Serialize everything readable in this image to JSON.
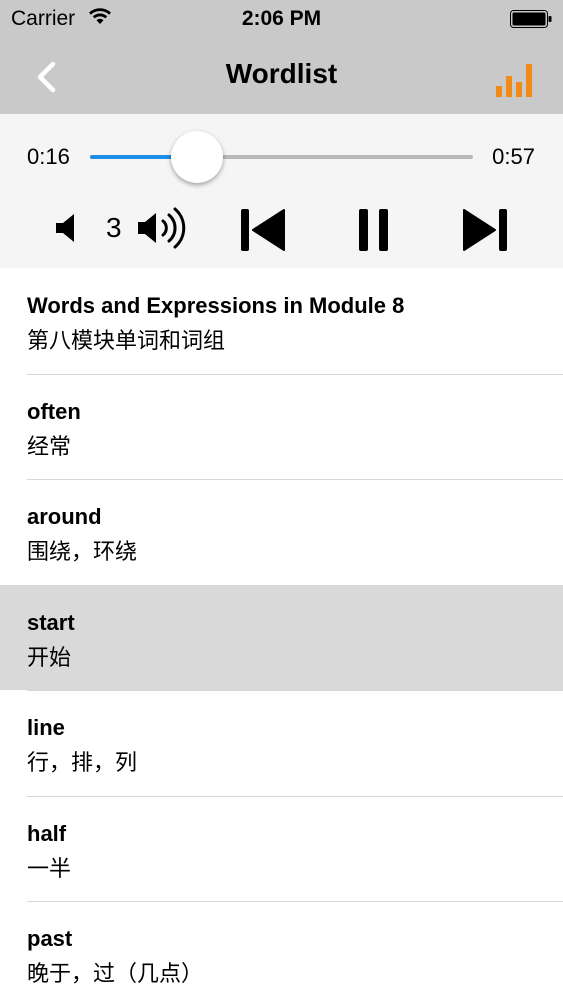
{
  "status_bar": {
    "carrier": "Carrier",
    "time": "2:06 PM"
  },
  "nav": {
    "title": "Wordlist",
    "accent_color": "#f28a1a"
  },
  "player": {
    "current_time": "0:16",
    "total_time": "0:57",
    "progress": 0.28,
    "progress_color": "#1e8ee6",
    "volume_level": "3"
  },
  "wordlist": [
    {
      "en": "Words and Expressions in Module 8",
      "zh": "第八模块单词和词组",
      "selected": false
    },
    {
      "en": "often",
      "zh": "经常",
      "selected": false
    },
    {
      "en": "around",
      "zh": "围绕，环绕",
      "selected": false
    },
    {
      "en": "start",
      "zh": "开始",
      "selected": true
    },
    {
      "en": "line",
      "zh": "行，排，列",
      "selected": false
    },
    {
      "en": "half",
      "zh": "一半",
      "selected": false
    },
    {
      "en": "past",
      "zh": "晚于，过（几点）",
      "selected": false
    }
  ]
}
